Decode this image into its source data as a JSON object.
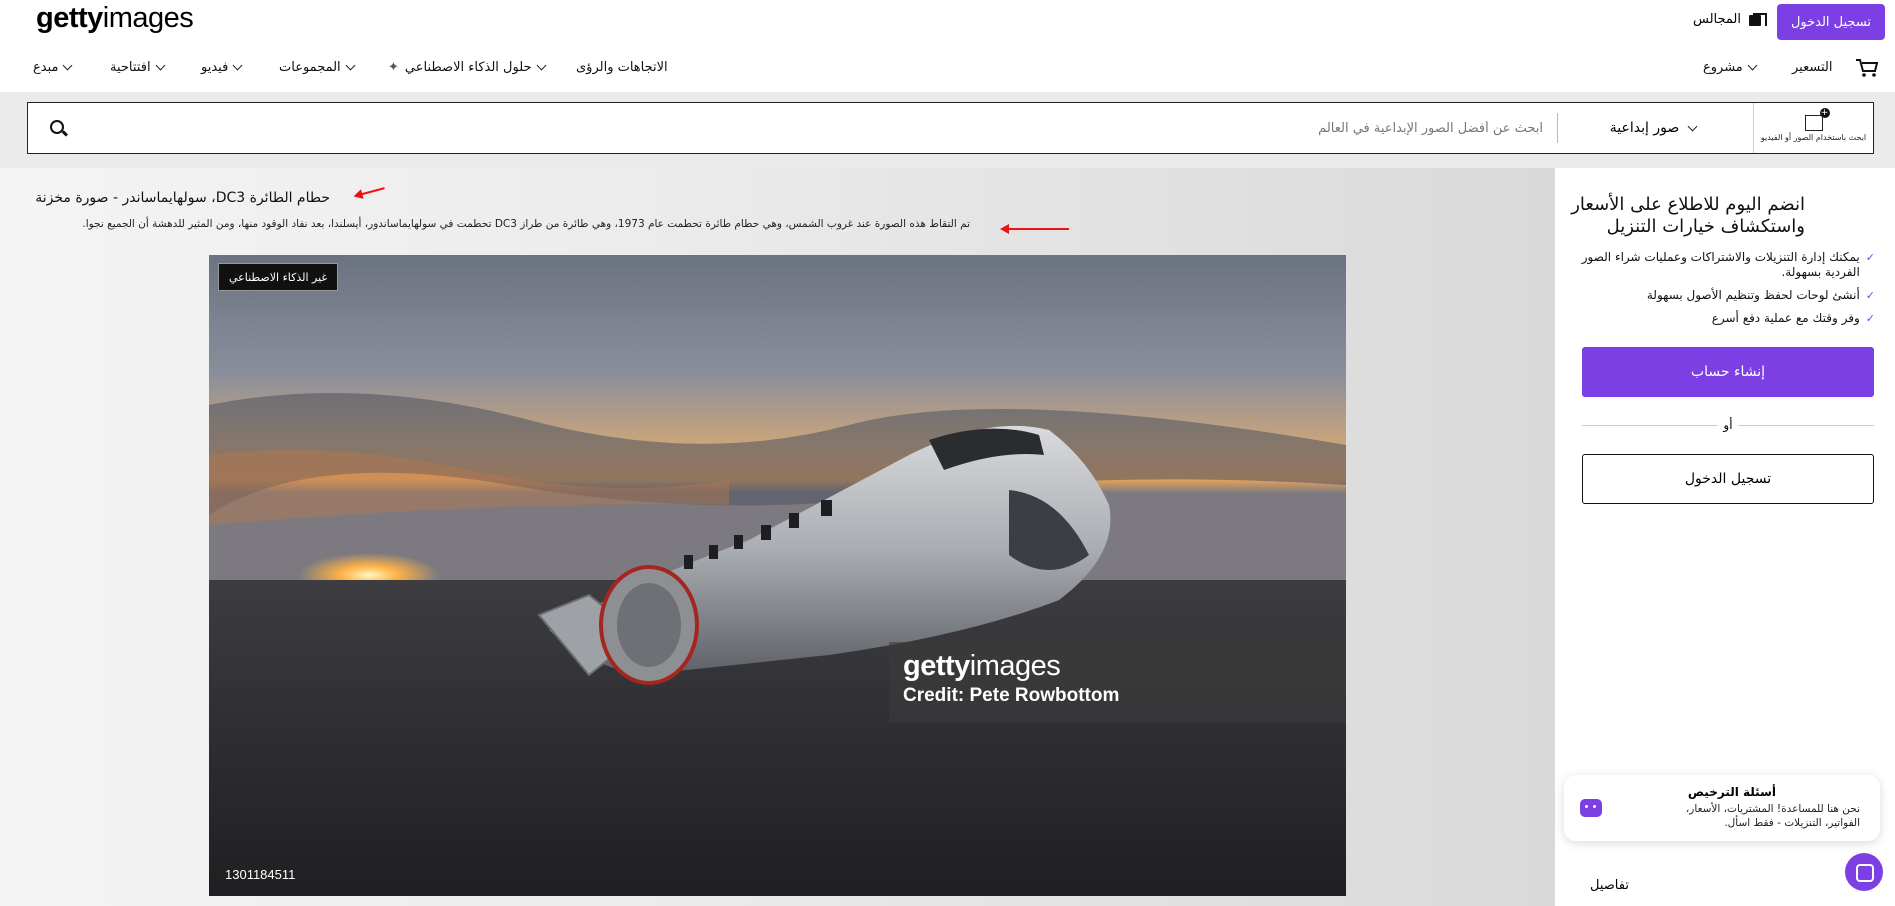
{
  "header": {
    "logo_light": "getty",
    "logo_bold": "images",
    "login_button": "تسجيل الدخول",
    "boards_label": "المجالس"
  },
  "nav": {
    "items": [
      {
        "label": "مبدع"
      },
      {
        "label": "افتتاحية"
      },
      {
        "label": "فيديو"
      },
      {
        "label": "المجموعات"
      },
      {
        "label": "حلول الذكاء الاصطناعي"
      },
      {
        "label": "الاتجاهات والرؤى"
      }
    ],
    "project_label": "مشروع",
    "pricing_label": "التسعير"
  },
  "search": {
    "placeholder": "ابحث عن أفضل الصور الإبداعية في العالم",
    "type_label": "صور إبداعية",
    "ai_search_label": "ابحث باستخدام الصور أو الفيديو"
  },
  "asset": {
    "title": "حطام الطائرة DC3، سولهايماساندر - صورة مخزنة",
    "description": "تم التقاط هذه الصورة عند غروب الشمس، وهي حطام طائرة تحطمت عام 1973، وهي طائرة من طراز DC3 تحطمت في سولهايماساندور، أيسلندا، بعد نفاد الوقود منها، ومن المثير للدهشة أن الجميع نجوا.",
    "ai_badge": "غير الذكاء الاصطناعي",
    "image_id": "1301184511",
    "watermark_light": "getty",
    "watermark_bold": "images",
    "credit": "Credit: Pete Rowbottom"
  },
  "signup": {
    "title": "انضم اليوم للاطلاع على الأسعار واستكشاف خيارات التنزيل",
    "benefits": [
      "يمكنك إدارة التنزيلات والاشتراكات وعمليات شراء الصور الفردية بسهولة.",
      "أنشئ لوحات لحفظ وتنظيم الأصول بسهولة",
      "وفر وقتك مع عملية دفع أسرع"
    ],
    "create_account": "إنشاء حساب",
    "or": "أو",
    "login": "تسجيل الدخول"
  },
  "chat": {
    "title": "أسئلة الترخيص",
    "text": "نحن هنا للمساعدة! المشتريات، الأسعار، الفواتير، التنزيلات - فقط اسأل."
  },
  "details_label": "تفاصيل",
  "colors": {
    "accent": "#7b3fe4",
    "annotation_arrow": "#e11111"
  }
}
